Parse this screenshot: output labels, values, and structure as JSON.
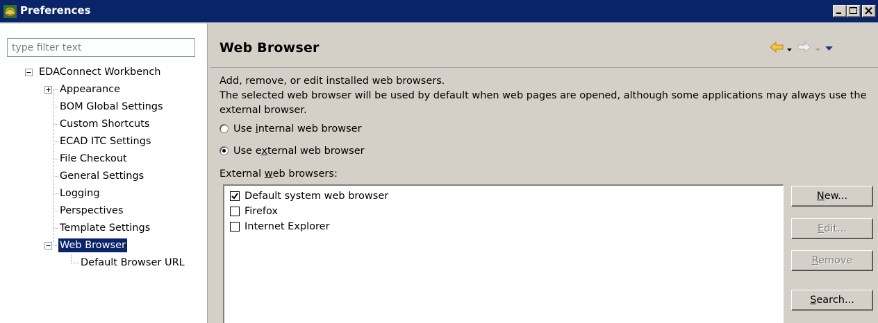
{
  "window": {
    "title": "Preferences"
  },
  "filter": {
    "placeholder": "type filter text"
  },
  "tree": {
    "root": "EDAConnect Workbench",
    "items": [
      "Appearance",
      "BOM Global Settings",
      "Custom Shortcuts",
      "ECAD ITC Settings",
      "File Checkout",
      "General Settings",
      "Logging",
      "Perspectives",
      "Template Settings",
      "Web Browser",
      "Default Browser URL"
    ],
    "selected": "Web Browser"
  },
  "page": {
    "title": "Web Browser",
    "description_line1": "Add, remove, or edit installed web browsers.",
    "description_line2": "The selected web browser will be used by default when web pages are opened, although some applications may always use the external browser.",
    "radio_internal": {
      "pre": "Use ",
      "mnemonic": "i",
      "post": "nternal web browser",
      "checked": false
    },
    "radio_external": {
      "pre": "Use e",
      "mnemonic": "x",
      "post": "ternal web browser",
      "checked": true
    },
    "list_label": {
      "pre": "External ",
      "mnemonic": "w",
      "post": "eb browsers:"
    },
    "browsers": [
      {
        "name": "Default system web browser",
        "checked": true
      },
      {
        "name": "Firefox",
        "checked": false
      },
      {
        "name": "Internet Explorer",
        "checked": false
      }
    ],
    "buttons": {
      "new": {
        "mnemonic": "N",
        "rest": "ew..."
      },
      "edit": {
        "mnemonic": "E",
        "rest": "dit..."
      },
      "remove": {
        "mnemonic": "R",
        "rest": "emove"
      },
      "search": {
        "mnemonic": "S",
        "rest": "earch..."
      }
    }
  },
  "icons": {
    "app": "eclipse-icon",
    "back": "back-arrow-icon",
    "forward": "forward-arrow-icon",
    "menu": "view-menu-icon"
  },
  "colors": {
    "titlebar": "#0a246a",
    "selection": "#0a246a",
    "dialog": "#d4d0c8",
    "back_arrow": "#f0b400"
  }
}
